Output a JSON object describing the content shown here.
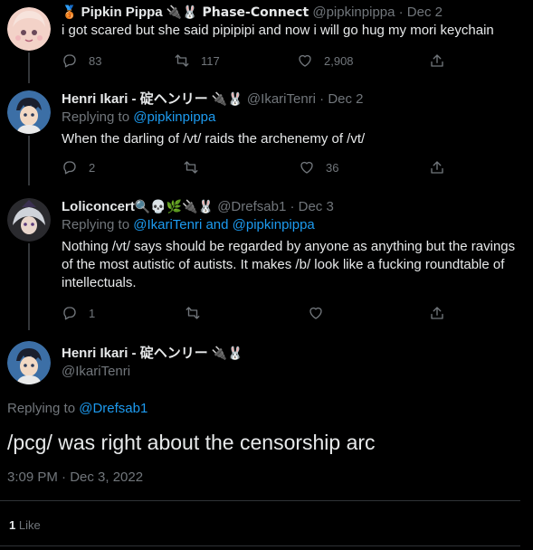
{
  "tweets": [
    {
      "name": "Pipkin Pippa",
      "badges": "🥉",
      "name_extra": "🔌🐰 Phase-Connect",
      "handle": "@pipkinpippa",
      "date": "· Dec 2",
      "text": "i got scared but she said pipipipi and now i will go hug my mori keychain",
      "replies": "83",
      "retweets": "117",
      "likes": "2,908"
    },
    {
      "name": "Henri Ikari - 碇ヘンリー",
      "badges": "🔌🐰",
      "handle": "@IkariTenri",
      "date": "· Dec 2",
      "replying_prefix": "Replying to ",
      "replying_to": "@pipkinpippa",
      "text": "When the darling of /vt/ raids the archenemy of /vt/",
      "replies": "2",
      "retweets": "",
      "likes": "36"
    },
    {
      "name": "Loliconcert",
      "badges": "🔍💀🌿🔌🐰",
      "handle": "@Drefsab1",
      "date": "· Dec 3",
      "replying_prefix": "Replying to ",
      "replying_to": "@IkariTenri and @pipkinpippa",
      "text_lines": [
        "Nothing /vt/ says should be regarded by anyone as anything but the ravings",
        "of the most autistic of autists. It makes /b/ look like a fucking roundtable of",
        "intellectuals."
      ],
      "replies": "1",
      "retweets": "",
      "likes": ""
    }
  ],
  "main": {
    "name": "Henri Ikari - 碇ヘンリー",
    "badges": "🔌🐰",
    "handle": "@IkariTenri",
    "replying_prefix": "Replying to ",
    "replying_to": "@Drefsab1",
    "text": "/pcg/ was right about the censorship arc",
    "timestamp": "3:09 PM · Dec 3, 2022",
    "like_count": "1",
    "like_label": " Like"
  },
  "colors": {
    "background": "#000000",
    "text": "#e7e9ea",
    "muted": "#71767b",
    "link": "#1d9bf0"
  }
}
